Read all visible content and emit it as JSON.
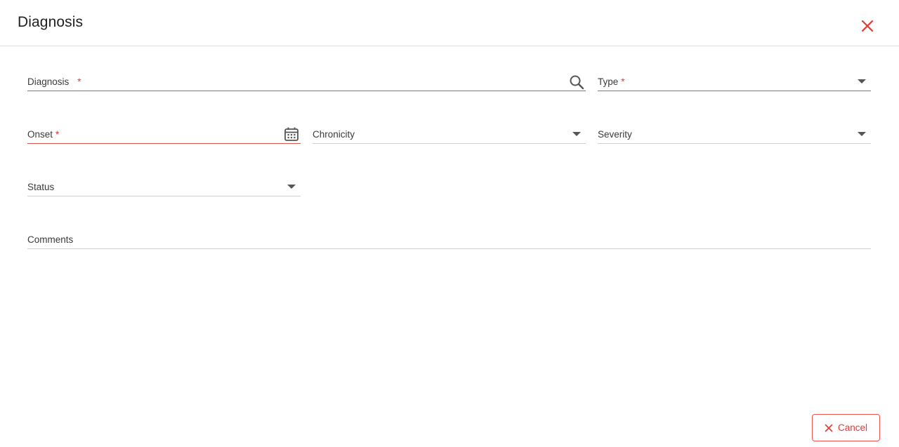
{
  "dialog": {
    "title": "Diagnosis"
  },
  "icons": {
    "close": "close-icon",
    "search": "search-icon",
    "calendar": "calendar-icon",
    "dropdown": "chevron-down-icon"
  },
  "colors": {
    "accent": "#e53935",
    "required_line": "#d9534f",
    "line": "#cfcfcf"
  },
  "form": {
    "diagnosis": {
      "label": "Diagnosis",
      "required_mark": "*"
    },
    "type": {
      "label": "Type",
      "required_mark": "*"
    },
    "onset": {
      "label": "Onset",
      "required_mark": "*"
    },
    "chronicity": {
      "label": "Chronicity"
    },
    "severity": {
      "label": "Severity"
    },
    "status": {
      "label": "Status"
    },
    "comments": {
      "label": "Comments"
    }
  },
  "footer": {
    "cancel_label": "Cancel"
  }
}
